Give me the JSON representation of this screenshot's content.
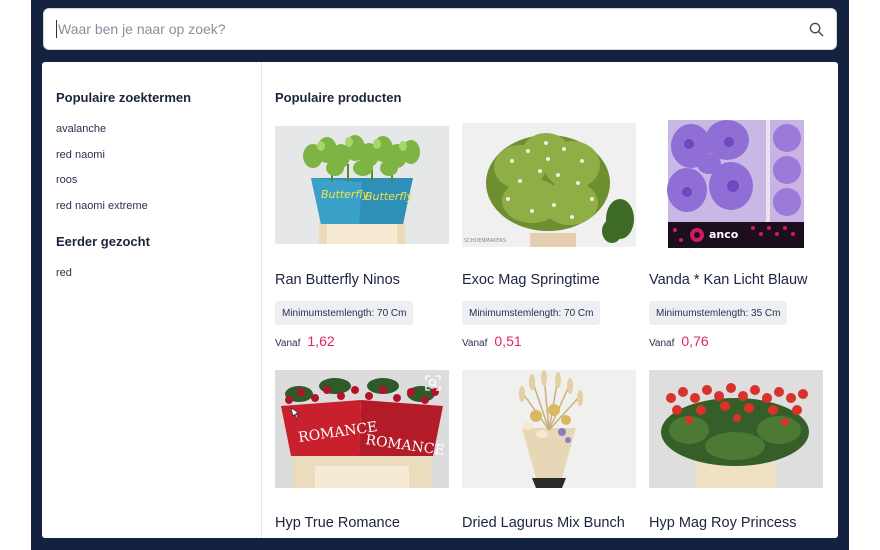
{
  "search": {
    "placeholder": "Waar ben je naar op zoek?",
    "icon": "search-icon"
  },
  "sidebar": {
    "popular_title": "Populaire zoektermen",
    "popular_terms": [
      "avalanche",
      "red naomi",
      "roos",
      "red naomi extreme"
    ],
    "recent_title": "Eerder gezocht",
    "recent_terms": [
      "red"
    ]
  },
  "products": {
    "title": "Populaire producten",
    "price_prefix": "Vanaf",
    "items": [
      {
        "name": "Ran Butterfly Ninos",
        "stem": "Minimumstemlength: 70 Cm",
        "price": "1,62"
      },
      {
        "name": "Exoc Mag Springtime",
        "stem": "Minimumstemlength: 70 Cm",
        "price": "0,51"
      },
      {
        "name": "Vanda * Kan Licht Blauw",
        "stem": "Minimumstemlength: 35 Cm",
        "price": "0,76"
      },
      {
        "name": "Hyp True Romance"
      },
      {
        "name": "Dried Lagurus Mix Bunch"
      },
      {
        "name": "Hyp Mag Roy Princess"
      }
    ],
    "image_text": {
      "butterfly_sleeve": "Butterfly",
      "schoenmaker": "SCHOENMAKERS",
      "anco": "anco",
      "romance": "ROMANCE"
    }
  },
  "colors": {
    "frame": "#14213f",
    "price": "#e0245e",
    "title": "#1c2340"
  }
}
